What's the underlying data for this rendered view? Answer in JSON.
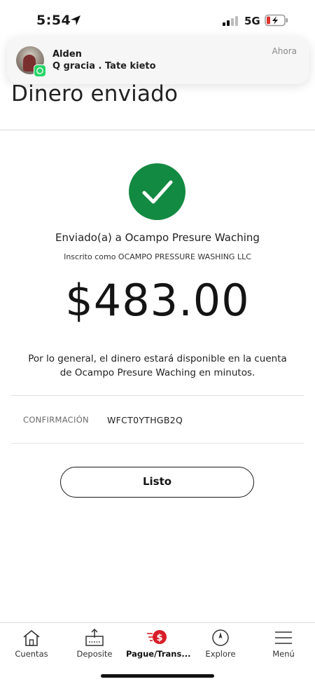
{
  "status_bar": {
    "time": "5:54",
    "network": "5G"
  },
  "notification": {
    "sender": "Alden",
    "message": "Q gracia . Tate kieto",
    "time": "Ahora",
    "app_icon": "whatsapp-icon"
  },
  "page": {
    "title": "Dinero enviado"
  },
  "confirmation": {
    "recipient": "Enviado(a) a Ocampo Presure Waching",
    "enrolled_as": "Inscrito como OCAMPO PRESSURE WASHING LLC",
    "amount": "$483.00",
    "availability": "Por lo general, el dinero estará disponible en la cuenta de Ocampo Presure Waching en minutos.",
    "confirmation_label": "CONFIRMACIÓN",
    "confirmation_number": "WFCT0YTHGB2Q",
    "done_label": "Listo",
    "success_color": "#138a41"
  },
  "tab_bar": {
    "tabs": [
      {
        "label": "Cuentas",
        "icon": "home-icon"
      },
      {
        "label": "Deposite",
        "icon": "deposit-icon"
      },
      {
        "label": "Pague/Trans...",
        "icon": "pay-transfer-icon",
        "active": true
      },
      {
        "label": "Explore",
        "icon": "compass-icon"
      },
      {
        "label": "Menú",
        "icon": "menu-icon"
      }
    ],
    "accent_color": "#d71e28"
  }
}
